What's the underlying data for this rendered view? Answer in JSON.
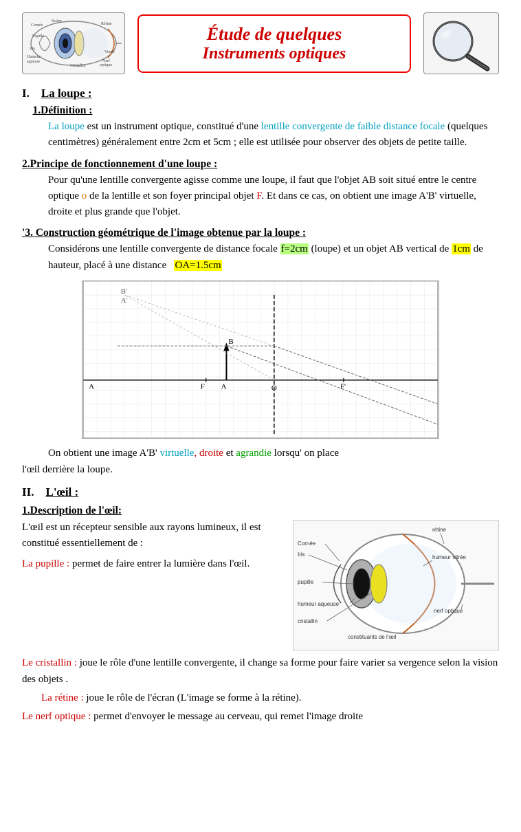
{
  "header": {
    "title_main": "Étude de quelques",
    "title_sub": "Instruments optiques"
  },
  "section1": {
    "roman": "I.",
    "title": "La loupe :",
    "sub1": {
      "num": "1.",
      "label": "Définition  :",
      "para": "La loupe est un instrument optique, constitué d'une lentille convergente de faible distance focale (quelques centimètres) généralement  entre 2cm et 5cm ; elle est utilisée pour observer des objets de petite taille."
    },
    "sub2": {
      "num": "2.",
      "label": "Principe de fonctionnement d'une loupe :",
      "para": "Pour qu'une lentille convergente  agisse  comme une loupe, il faut que l'objet AB soit situé entre le centre optique o de la lentille et son foyer principal objet F. Et dans ce cas, on obtient une image A'B' virtuelle, droite et plus grande que l'objet."
    },
    "sub3": {
      "num": "3.",
      "label": "Construction géométrique de l'image obtenue par la loupe :",
      "para1_before": "Considérons une lentille convergente de distance focale ",
      "f_value": "f=2cm",
      "para1_mid": " (loupe) et un objet AB vertical de ",
      "ab_value": "1cm",
      "para1_end": " de hauteur, placé à une distance ",
      "oa_value": "OA=1.5cm",
      "para2_before": "On obtient une image A'B' ",
      "virtuelle": "virtuelle",
      "comma1": ", ",
      "droite": "droite",
      "et": " et ",
      "agrandie": "agrandie",
      "para2_end": " lorsqu' on place",
      "para3": "l'œil derrière la loupe."
    }
  },
  "section2": {
    "roman": "II.",
    "title": "L'œil :",
    "sub1": {
      "num": "1.",
      "label": "Description de l'œil:",
      "para1": "L'œil est un  récepteur sensible aux rayons lumineux, il est  constitué essentiellement de :",
      "pupille_label": "La pupille :",
      "pupille_text": " permet de faire entrer la lumière dans l'œil."
    }
  },
  "eye_diagram": {
    "labels": [
      "Cornée",
      "Iris",
      "pupille",
      "humeur aqueuse",
      "cristallin",
      "rétine",
      "humeur vitrée",
      "nerf optique",
      "constituants de l'œil"
    ]
  },
  "bottom": {
    "cristallin_label": "Le cristallin :",
    "cristallin_text": " joue le rôle d'une lentille convergente, il change sa forme pour faire varier sa vergence selon la vision des objets .",
    "retine_label": "La rétine :",
    "retine_text": " joue le rôle de l'écran (L'image  se forme à la rétine).",
    "nerf_label": "Le nerf optique :",
    "nerf_text": " permet d'envoyer le message  au cerveau, qui remet l'image droite"
  }
}
